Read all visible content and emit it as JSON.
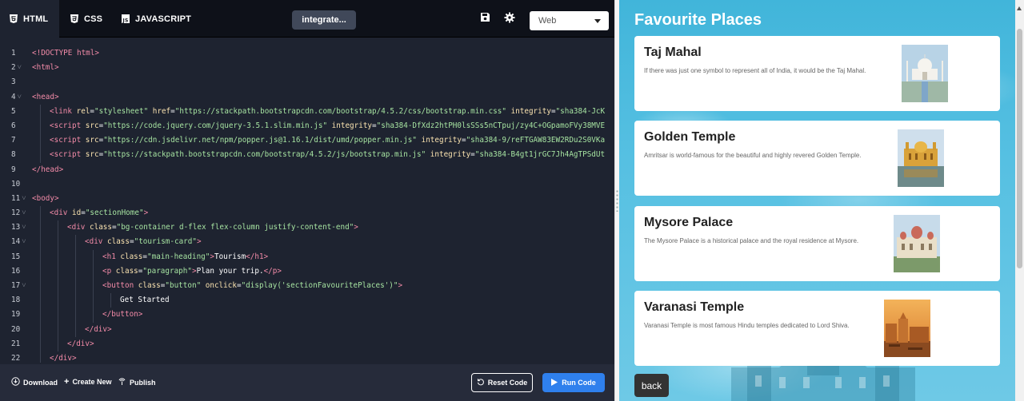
{
  "editor": {
    "tabs": [
      {
        "label": "HTML",
        "icon": "html5-icon",
        "active": true
      },
      {
        "label": "CSS",
        "icon": "css3-icon",
        "active": false
      },
      {
        "label": "JAVASCRIPT",
        "icon": "js-icon",
        "active": false
      }
    ],
    "project_name": "integrate...",
    "save_icon": "save-icon",
    "settings_icon": "gear-icon",
    "view_select": {
      "value": "Web"
    },
    "code_lines": [
      {
        "n": "1",
        "fold": false,
        "indent": 0,
        "parts": [
          [
            "t",
            "<!DOCTYPE html>"
          ]
        ]
      },
      {
        "n": "2",
        "fold": true,
        "indent": 0,
        "parts": [
          [
            "t",
            "<html>"
          ]
        ]
      },
      {
        "n": "3",
        "fold": false,
        "indent": 0,
        "parts": []
      },
      {
        "n": "4",
        "fold": true,
        "indent": 0,
        "parts": [
          [
            "t",
            "<head>"
          ]
        ]
      },
      {
        "n": "5",
        "fold": false,
        "indent": 1,
        "parts": [
          [
            "t",
            "<link "
          ],
          [
            "a",
            "rel"
          ],
          [
            "txt",
            "="
          ],
          [
            "s",
            "\"stylesheet\" "
          ],
          [
            "a",
            "href"
          ],
          [
            "txt",
            "="
          ],
          [
            "s",
            "\"https://stackpath.bootstrapcdn.com/bootstrap/4.5.2/css/bootstrap.min.css\" "
          ],
          [
            "a",
            "integrity"
          ],
          [
            "txt",
            "="
          ],
          [
            "s",
            "\"sha384-JcK"
          ]
        ]
      },
      {
        "n": "6",
        "fold": false,
        "indent": 1,
        "parts": [
          [
            "t",
            "<script "
          ],
          [
            "a",
            "src"
          ],
          [
            "txt",
            "="
          ],
          [
            "s",
            "\"https://code.jquery.com/jquery-3.5.1.slim.min.js\" "
          ],
          [
            "a",
            "integrity"
          ],
          [
            "txt",
            "="
          ],
          [
            "s",
            "\"sha384-DfXdz2htPH0lsSSs5nCTpuj/zy4C+OGpamoFVy38MVE"
          ]
        ]
      },
      {
        "n": "7",
        "fold": false,
        "indent": 1,
        "parts": [
          [
            "t",
            "<script "
          ],
          [
            "a",
            "src"
          ],
          [
            "txt",
            "="
          ],
          [
            "s",
            "\"https://cdn.jsdelivr.net/npm/popper.js@1.16.1/dist/umd/popper.min.js\" "
          ],
          [
            "a",
            "integrity"
          ],
          [
            "txt",
            "="
          ],
          [
            "s",
            "\"sha384-9/reFTGAW83EW2RDu2S0VKa"
          ]
        ]
      },
      {
        "n": "8",
        "fold": false,
        "indent": 1,
        "parts": [
          [
            "t",
            "<script "
          ],
          [
            "a",
            "src"
          ],
          [
            "txt",
            "="
          ],
          [
            "s",
            "\"https://stackpath.bootstrapcdn.com/bootstrap/4.5.2/js/bootstrap.min.js\" "
          ],
          [
            "a",
            "integrity"
          ],
          [
            "txt",
            "="
          ],
          [
            "s",
            "\"sha384-B4gt1jrGC7Jh4AgTPSdUt"
          ]
        ]
      },
      {
        "n": "9",
        "fold": false,
        "indent": 0,
        "parts": [
          [
            "t",
            "</head>"
          ]
        ]
      },
      {
        "n": "10",
        "fold": false,
        "indent": 0,
        "parts": []
      },
      {
        "n": "11",
        "fold": true,
        "indent": 0,
        "parts": [
          [
            "t",
            "<body>"
          ]
        ]
      },
      {
        "n": "12",
        "fold": true,
        "indent": 1,
        "parts": [
          [
            "t",
            "<div "
          ],
          [
            "a",
            "id"
          ],
          [
            "txt",
            "="
          ],
          [
            "s",
            "\"sectionHome\""
          ],
          [
            "t",
            ">"
          ]
        ]
      },
      {
        "n": "13",
        "fold": true,
        "indent": 2,
        "parts": [
          [
            "t",
            "<div "
          ],
          [
            "a",
            "class"
          ],
          [
            "txt",
            "="
          ],
          [
            "s",
            "\"bg-container d-flex flex-column justify-content-end\""
          ],
          [
            "t",
            ">"
          ]
        ]
      },
      {
        "n": "14",
        "fold": true,
        "indent": 3,
        "parts": [
          [
            "t",
            "<div "
          ],
          [
            "a",
            "class"
          ],
          [
            "txt",
            "="
          ],
          [
            "s",
            "\"tourism-card\""
          ],
          [
            "t",
            ">"
          ]
        ]
      },
      {
        "n": "15",
        "fold": false,
        "indent": 4,
        "parts": [
          [
            "t",
            "<h1 "
          ],
          [
            "a",
            "class"
          ],
          [
            "txt",
            "="
          ],
          [
            "s",
            "\"main-heading\""
          ],
          [
            "t",
            ">"
          ],
          [
            "txt",
            "Tourism"
          ],
          [
            "t",
            "</h1>"
          ]
        ]
      },
      {
        "n": "16",
        "fold": false,
        "indent": 4,
        "parts": [
          [
            "t",
            "<p "
          ],
          [
            "a",
            "class"
          ],
          [
            "txt",
            "="
          ],
          [
            "s",
            "\"paragraph\""
          ],
          [
            "t",
            ">"
          ],
          [
            "txt",
            "Plan your trip."
          ],
          [
            "t",
            "</p>"
          ]
        ]
      },
      {
        "n": "17",
        "fold": true,
        "indent": 4,
        "parts": [
          [
            "t",
            "<button "
          ],
          [
            "a",
            "class"
          ],
          [
            "txt",
            "="
          ],
          [
            "s",
            "\"button\" "
          ],
          [
            "a",
            "onclick"
          ],
          [
            "txt",
            "="
          ],
          [
            "s",
            "\"display('sectionFavouritePlaces')\""
          ],
          [
            "t",
            ">"
          ]
        ]
      },
      {
        "n": "18",
        "fold": false,
        "indent": 5,
        "parts": [
          [
            "txt",
            "Get Started"
          ]
        ]
      },
      {
        "n": "19",
        "fold": false,
        "indent": 4,
        "parts": [
          [
            "t",
            "</button>"
          ]
        ]
      },
      {
        "n": "20",
        "fold": false,
        "indent": 3,
        "parts": [
          [
            "t",
            "</div>"
          ]
        ]
      },
      {
        "n": "21",
        "fold": false,
        "indent": 2,
        "parts": [
          [
            "t",
            "</div>"
          ]
        ]
      },
      {
        "n": "22",
        "fold": false,
        "indent": 1,
        "parts": [
          [
            "t",
            "</div>"
          ]
        ]
      }
    ],
    "bottom": {
      "download": "Download",
      "create_new": "Create New",
      "publish": "Publish",
      "reset": "Reset Code",
      "run": "Run Code"
    }
  },
  "preview": {
    "heading": "Favourite Places",
    "cards": [
      {
        "title": "Taj Mahal",
        "desc": "If there was just one symbol to represent all of India, it would be the Taj Mahal.",
        "image": "taj-mahal-photo"
      },
      {
        "title": "Golden Temple",
        "desc": "Amritsar is world-famous for the beautiful and highly revered Golden Temple.",
        "image": "golden-temple-photo"
      },
      {
        "title": "Mysore Palace",
        "desc": "The Mysore Palace is a historical palace and the royal residence at Mysore.",
        "image": "mysore-palace-photo"
      },
      {
        "title": "Varanasi Temple",
        "desc": "Varanasi Temple is most famous Hindu temples dedicated to Lord Shiva.",
        "image": "varanasi-ghat-photo"
      }
    ],
    "back_label": "back"
  },
  "colors": {
    "editor_bg": "#1e2330",
    "topbar_bg": "#0e1119",
    "run_button": "#2f80ed",
    "preview_sky": "#41b5da"
  }
}
